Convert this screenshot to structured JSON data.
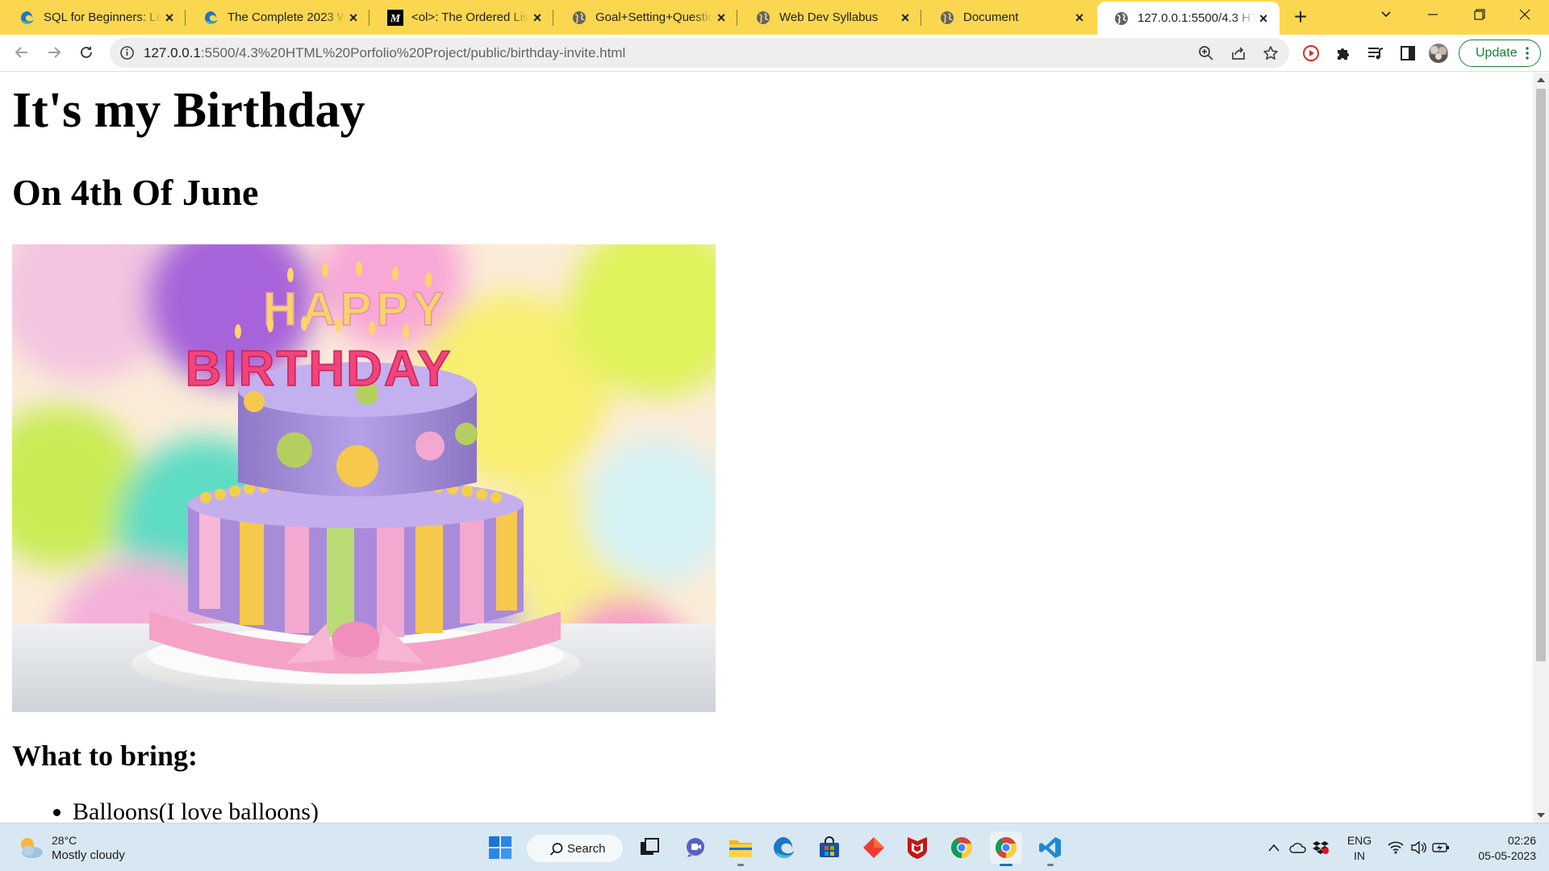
{
  "browser": {
    "tabs": [
      {
        "title": "SQL for Beginners: Learn SQL",
        "favicon": "edge-favicon-icon",
        "active": false
      },
      {
        "title": "The Complete 2023 Web Development",
        "favicon": "edge-favicon-icon",
        "active": false
      },
      {
        "title": "<ol>: The Ordered List element",
        "favicon": "mdn-favicon-icon",
        "active": false
      },
      {
        "title": "Goal+Setting+Questions",
        "favicon": "globe-icon",
        "active": false
      },
      {
        "title": "Web Dev Syllabus",
        "favicon": "globe-icon",
        "active": false
      },
      {
        "title": "Document",
        "favicon": "globe-icon",
        "active": false
      },
      {
        "title": "127.0.0.1:5500/4.3 HTML Portfolio",
        "favicon": "globe-icon",
        "active": true
      }
    ],
    "url_host": "127.0.0.1",
    "url_path": ":5500/4.3%20HTML%20Porfolio%20Project/public/birthday-invite.html",
    "update_label": "Update",
    "colors": {
      "tabstrip": "#fad74f",
      "update": "#188038"
    }
  },
  "page": {
    "heading": "It's my Birthday",
    "date_heading": "On 4th Of June",
    "image_text": "HAPPY BIRTHDAY",
    "bring_heading": "What to bring:",
    "list_items": [
      "Balloons(I love balloons)"
    ]
  },
  "taskbar": {
    "temperature": "28°C",
    "condition": "Mostly cloudy",
    "search_label": "Search",
    "language": "ENG",
    "region": "IN",
    "time": "02:26",
    "date": "05-05-2023"
  }
}
